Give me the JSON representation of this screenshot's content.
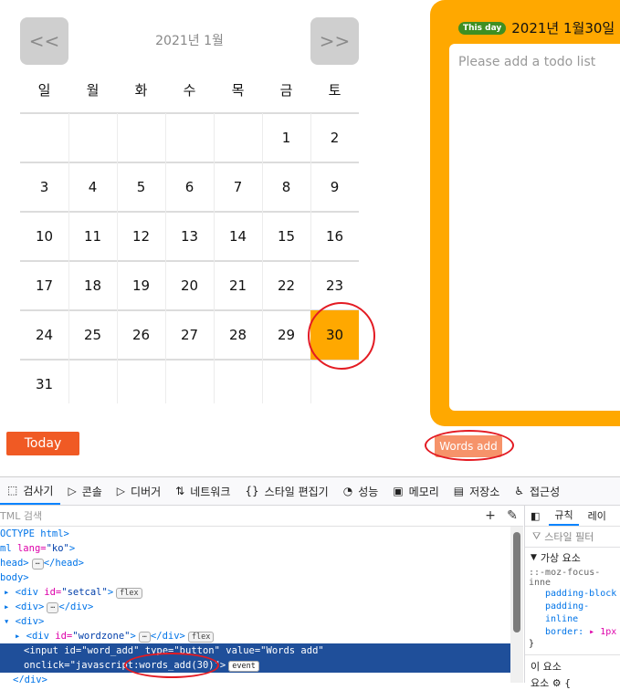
{
  "calendar": {
    "prev_label": "<<",
    "next_label": ">>",
    "month_title": "2021년 1월",
    "weekdays": [
      "일",
      "월",
      "화",
      "수",
      "목",
      "금",
      "토"
    ],
    "weeks": [
      [
        "",
        "",
        "",
        "",
        "",
        "1",
        "2"
      ],
      [
        "3",
        "4",
        "5",
        "6",
        "7",
        "8",
        "9"
      ],
      [
        "10",
        "11",
        "12",
        "13",
        "14",
        "15",
        "16"
      ],
      [
        "17",
        "18",
        "19",
        "20",
        "21",
        "22",
        "23"
      ],
      [
        "24",
        "25",
        "26",
        "27",
        "28",
        "29",
        "30"
      ],
      [
        "31",
        "",
        "",
        "",
        "",
        "",
        ""
      ]
    ],
    "selected_day": "30",
    "selected_color": "#ffa800",
    "today_label": "Today",
    "today_color": "#f05a24"
  },
  "todo": {
    "badge": "This day",
    "date": "2021년 1월30일",
    "placeholder": "Please add a todo list",
    "panel_color": "#ffa800",
    "words_add_label": "Words add",
    "words_add_color": "#f6936a"
  },
  "annotations": {
    "circle_color": "#e31b23"
  },
  "devtools": {
    "tabs": [
      {
        "icon": "inspector-icon",
        "glyph": "⬚",
        "label": "검사기"
      },
      {
        "icon": "console-icon",
        "glyph": "▷",
        "label": "콘솔"
      },
      {
        "icon": "debugger-icon",
        "glyph": "▷",
        "label": "디버거"
      },
      {
        "icon": "network-icon",
        "glyph": "⇅",
        "label": "네트워크"
      },
      {
        "icon": "style-editor-icon",
        "glyph": "{}",
        "label": "스타일 편집기"
      },
      {
        "icon": "performance-icon",
        "glyph": "◔",
        "label": "성능"
      },
      {
        "icon": "memory-icon",
        "glyph": "▣",
        "label": "메모리"
      },
      {
        "icon": "storage-icon",
        "glyph": "▤",
        "label": "저장소"
      },
      {
        "icon": "accessibility-icon",
        "glyph": "♿",
        "label": "접근성"
      }
    ],
    "search_placeholder": "TML 검색",
    "dom": {
      "l1": "OCTYPE html>",
      "l2_tag": "ml",
      "l2_attr": " lang=",
      "l2_val": "\"ko\"",
      "l2_end": ">",
      "l3": "head>",
      "l3_end": "</head>",
      "l4": "body>",
      "l5_tag": "<div",
      "l5_attr": " id=",
      "l5_val": "\"setcal\"",
      "l5_end": ">",
      "l6_tag": "<div>",
      "l6_end": "</div>",
      "l7_tag": "<div>",
      "l8_tag": "<div",
      "l8_attr": " id=",
      "l8_val": "\"wordzone\"",
      "l8_end": ">",
      "l8_close": "</div>",
      "l9": "<input id=\"word_add\" type=\"button\" value=\"Words add\"",
      "l10": "onclick=\"javascript:words_add(30)\">",
      "l11": "</div>",
      "badge_flex": "flex",
      "badge_event": "event",
      "ellipsis": "⋯"
    },
    "rules": {
      "tab_active": "규칙",
      "tab_next": "레이",
      "filter_placeholder": "스타일 필터",
      "pseudo_header": "가상 요소",
      "selector": "::-moz-focus-inne",
      "props": [
        {
          "name": "padding-block",
          "value": ""
        },
        {
          "name": "padding-inline",
          "value": ""
        },
        {
          "name": "border:",
          "value": "1px"
        }
      ],
      "close_brace": "}",
      "this_element": "이 요소",
      "element_line": "요소 ⚙ {"
    }
  }
}
